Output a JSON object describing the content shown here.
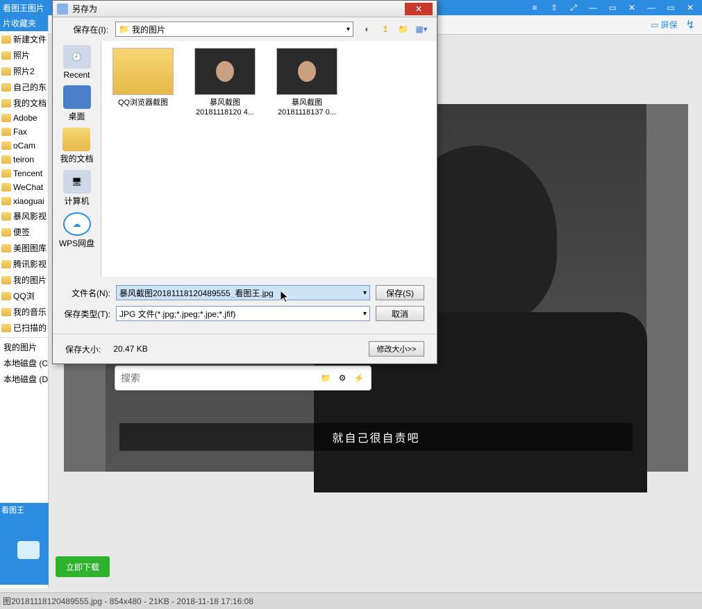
{
  "bgWindow": {
    "title": "看图王图片",
    "toolbar": {
      "screen": "屏保"
    }
  },
  "sidebar": {
    "header": "片收藏夹",
    "items": [
      "新建文件",
      "照片",
      "照片2",
      "自己的东",
      "我的文档",
      "Adobe",
      "Fax",
      "oCam",
      "teiron",
      "Tencent",
      "WeChat",
      "xiaoguai",
      "暴风影视",
      "便签",
      "美图图库",
      "腾讯影视",
      "我的图片",
      "QQ浏",
      "我的音乐",
      "已扫描的"
    ],
    "plain": [
      "我的图片",
      "本地磁盘 (C",
      "本地磁盘 (D"
    ]
  },
  "bottomLeft": {
    "tag": "看图王"
  },
  "dlButton": "立即下载",
  "statusbar": "图20181118120489555.jpg - 854x480 - 21KB - 2018-11-18 17:16:08",
  "videoSubtitle": "就自己很自责吧",
  "search": {
    "placeholder": "搜索"
  },
  "dialog": {
    "title": "另存为",
    "saveInLabel": "保存在(I):",
    "saveInValue": "我的图片",
    "places": [
      {
        "key": "recent",
        "label": "Recent"
      },
      {
        "key": "desktop",
        "label": "桌面"
      },
      {
        "key": "mydocs",
        "label": "我的文档"
      },
      {
        "key": "computer",
        "label": "计算机"
      },
      {
        "key": "wps",
        "label": "WPS网盘"
      }
    ],
    "files": [
      {
        "type": "folder",
        "name": "QQ浏览器截图"
      },
      {
        "type": "image",
        "name": "暴风截图\n20181118120 4..."
      },
      {
        "type": "image",
        "name": "暴风截图\n20181118137 0..."
      }
    ],
    "fileNameLabel": "文件名(N):",
    "fileNameValue": "暴风截图20181118120489555_看图王.jpg",
    "fileTypeLabel": "保存类型(T):",
    "fileTypeValue": "JPG 文件(*.jpg;*.jpeg;*.jpe;*.jfif)",
    "saveBtn": "保存(S)",
    "cancelBtn": "取消",
    "sizeLabel": "保存大小:",
    "sizeValue": "20.47 KB",
    "resizeBtn": "修改大小>>"
  }
}
